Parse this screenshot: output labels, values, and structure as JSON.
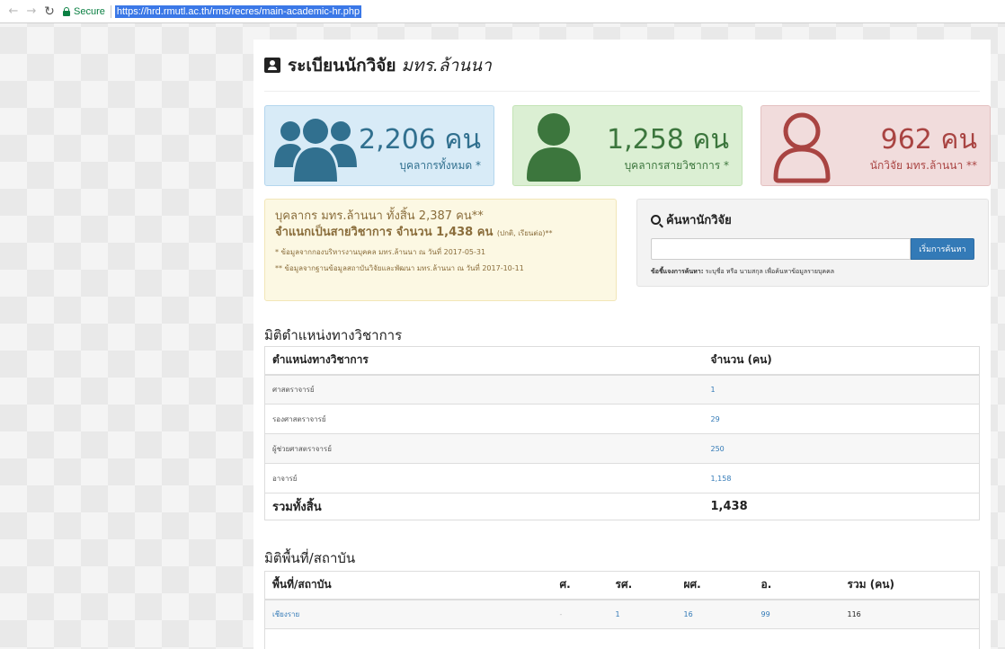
{
  "browser": {
    "secure_label": "Secure",
    "url": "https://hrd.rmutl.ac.th/rms/recres/main-academic-hr.php"
  },
  "header": {
    "title": "ระเบียนนักวิจัย",
    "title_em": "มทร.ล้านนา"
  },
  "stats": [
    {
      "number": "2,206 คน",
      "label": "บุคลากรทั้งหมด *",
      "color": "#31708f",
      "icon": "users-icon"
    },
    {
      "number": "1,258 คน",
      "label": "บุคลากรสายวิชาการ *",
      "color": "#3c763d",
      "icon": "user-icon"
    },
    {
      "number": "962 คน",
      "label": "นักวิจัย มทร.ล้านนา **",
      "color": "#a94442",
      "icon": "user-outline-icon"
    }
  ],
  "info": {
    "line1": "บุคลากร มทร.ล้านนา ทั้งสิ้น 2,387 คน**",
    "line2": "จำแนกเป็นสายวิชาการ จำนวน 1,438 คน",
    "line2_small": "(ปกติ, เรียนต่อ)**",
    "note1": "* ข้อมูลจากกองบริหารงานบุคคล มทร.ล้านนา ณ วันที่ 2017-05-31",
    "note2": "** ข้อมูลจากฐานข้อมูลสถาบันวิจัยและพัฒนา มทร.ล้านนา ณ วันที่ 2017-10-11"
  },
  "search": {
    "title": "ค้นหานักวิจัย",
    "placeholder": "",
    "button_label": "เริ่มการค้นหา",
    "help_bold": "ข้อชี้แจงการค้นหา:",
    "help_text": " ระบุชื่อ หรือ นามสกุล เพื่อค้นหาข้อมูลรายบุคคล"
  },
  "rank_section": {
    "title": "มิติตำแหน่งทางวิชาการ",
    "headers": [
      "ตำแหน่งทางวิชาการ",
      "จำนวน (คน)"
    ],
    "rows": [
      [
        "ศาสตราจารย์",
        "1"
      ],
      [
        "รองศาสตราจารย์",
        "29"
      ],
      [
        "ผู้ช่วยศาสตราจารย์",
        "250"
      ],
      [
        "อาจารย์",
        "1,158"
      ]
    ],
    "total": [
      "รวมทั้งสิ้น",
      "1,438"
    ]
  },
  "area_section": {
    "title": "มิติพื้นที่/สถาบัน",
    "headers": [
      "พื้นที่/สถาบัน",
      "ศ.",
      "รศ.",
      "ผศ.",
      "อ.",
      "รวม (คน)"
    ],
    "rows": [
      [
        "เชียงราย",
        "-",
        "1",
        "16",
        "99",
        "116"
      ]
    ]
  }
}
